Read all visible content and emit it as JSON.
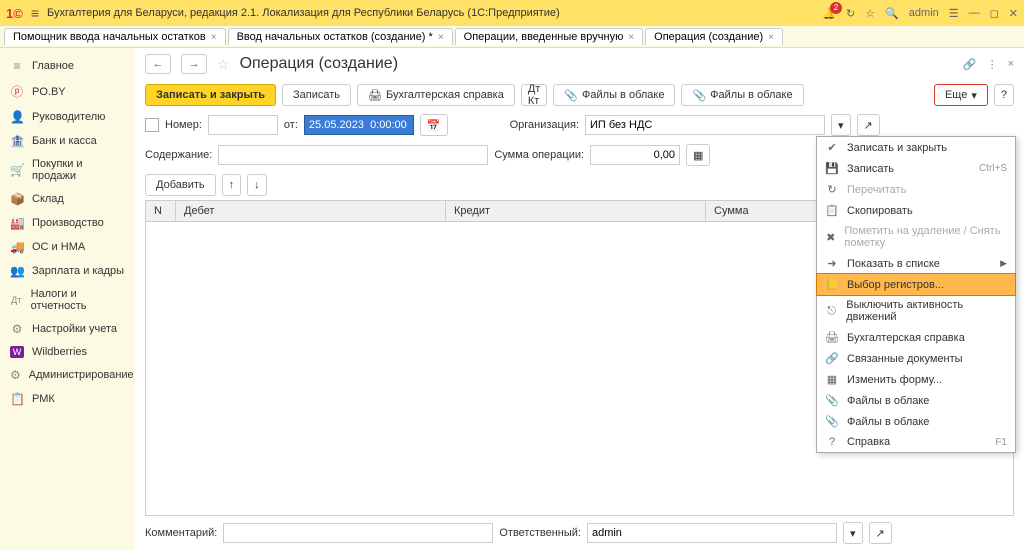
{
  "topbar": {
    "logo": "1©",
    "title": "Бухгалтерия для Беларуси, редакция 2.1. Локализация для Республики Беларусь   (1С:Предприятие)",
    "notif_count": "2",
    "user": "admin"
  },
  "tabs": [
    {
      "label": "Помощник ввода начальных остатков"
    },
    {
      "label": "Ввод начальных остатков (создание) *"
    },
    {
      "label": "Операции, введенные вручную"
    },
    {
      "label": "Операция (создание)",
      "active": true
    }
  ],
  "sidebar": {
    "items": [
      {
        "icon": "≡",
        "label": "Главное"
      },
      {
        "icon": "ⓟ",
        "label": "PO.BY"
      },
      {
        "icon": "👤",
        "label": "Руководителю"
      },
      {
        "icon": "🏦",
        "label": "Банк и касса"
      },
      {
        "icon": "🛒",
        "label": "Покупки и продажи"
      },
      {
        "icon": "📦",
        "label": "Склад"
      },
      {
        "icon": "🏭",
        "label": "Производство"
      },
      {
        "icon": "🚚",
        "label": "ОС и НМА"
      },
      {
        "icon": "👥",
        "label": "Зарплата и кадры"
      },
      {
        "icon": "Дт",
        "label": "Налоги и отчетность"
      },
      {
        "icon": "⚙",
        "label": "Настройки учета"
      },
      {
        "icon": "W",
        "label": "Wildberries"
      },
      {
        "icon": "⚙",
        "label": "Администрирование"
      },
      {
        "icon": "📋",
        "label": "РМК"
      }
    ]
  },
  "page": {
    "title": "Операция (создание)",
    "toolbar": {
      "save_close": "Записать и закрыть",
      "save": "Записать",
      "accounting_ref": "Бухгалтерская справка",
      "files_cloud": "Файлы в облаке",
      "more": "Еще",
      "help": "?"
    },
    "form": {
      "number_label": "Номер:",
      "from_label": "от:",
      "date_value": "25.05.2023  0:00:00",
      "org_label": "Организация:",
      "org_value": "ИП без НДС",
      "content_label": "Содержание:",
      "sum_label": "Сумма операции:",
      "sum_value": "0,00",
      "add": "Добавить",
      "comment_label": "Комментарий:",
      "responsible_label": "Ответственный:",
      "responsible_value": "admin"
    },
    "table": {
      "cols": {
        "n": "N",
        "debit": "Дебет",
        "credit": "Кредит",
        "sum": "Сумма"
      }
    }
  },
  "dropdown": {
    "items": [
      {
        "icon": "✔",
        "label": "Записать и закрыть"
      },
      {
        "icon": "💾",
        "label": "Записать",
        "shortcut": "Ctrl+S"
      },
      {
        "icon": "↻",
        "label": "Перечитать",
        "disabled": true
      },
      {
        "icon": "📋",
        "label": "Скопировать"
      },
      {
        "icon": "✖",
        "label": "Пометить на удаление / Снять пометку",
        "disabled": true
      },
      {
        "icon": "➜",
        "label": "Показать в списке",
        "submenu": true
      },
      {
        "icon": "📒",
        "label": "Выбор регистров...",
        "highlight": true
      },
      {
        "icon": "⎋",
        "label": "Выключить активность движений"
      },
      {
        "icon": "🖨",
        "label": "Бухгалтерская справка"
      },
      {
        "icon": "🔗",
        "label": "Связанные документы"
      },
      {
        "icon": "▦",
        "label": "Изменить форму..."
      },
      {
        "icon": "📎",
        "label": "Файлы в облаке"
      },
      {
        "icon": "📎",
        "label": "Файлы в облаке"
      },
      {
        "icon": "?",
        "label": "Справка",
        "shortcut": "F1"
      }
    ]
  }
}
